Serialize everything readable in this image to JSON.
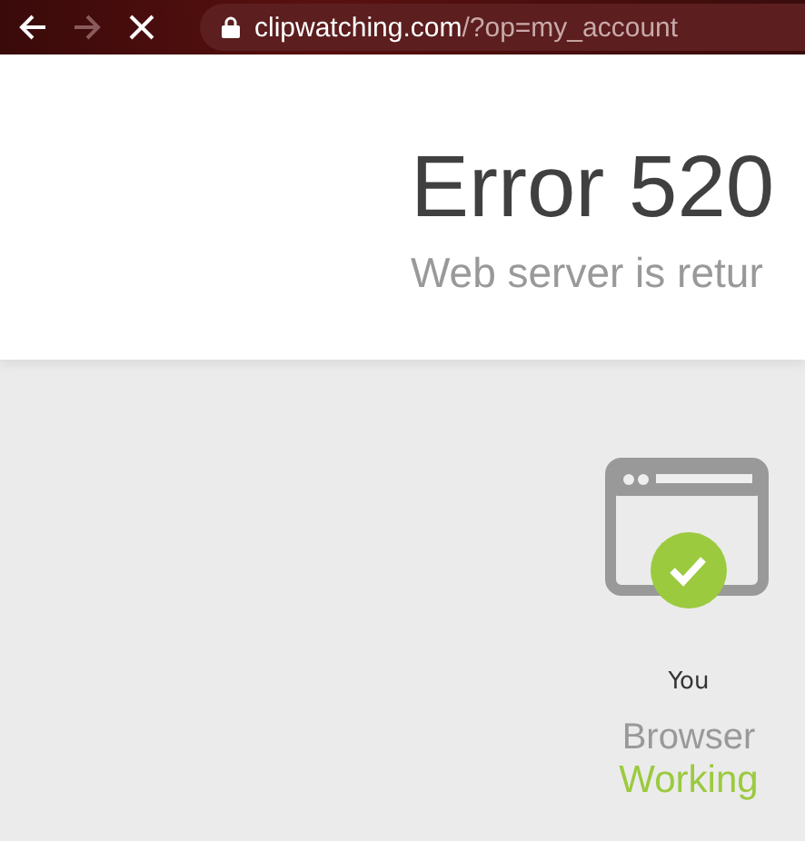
{
  "browser_bar": {
    "url_host": "clipwatching.com",
    "url_path": "/?op=my_account",
    "forward_disabled": true
  },
  "error": {
    "title": "Error 520",
    "subtitle": "Web server is retur"
  },
  "node": {
    "label": "You",
    "name": "Browser",
    "status": "Working",
    "ok": true
  }
}
